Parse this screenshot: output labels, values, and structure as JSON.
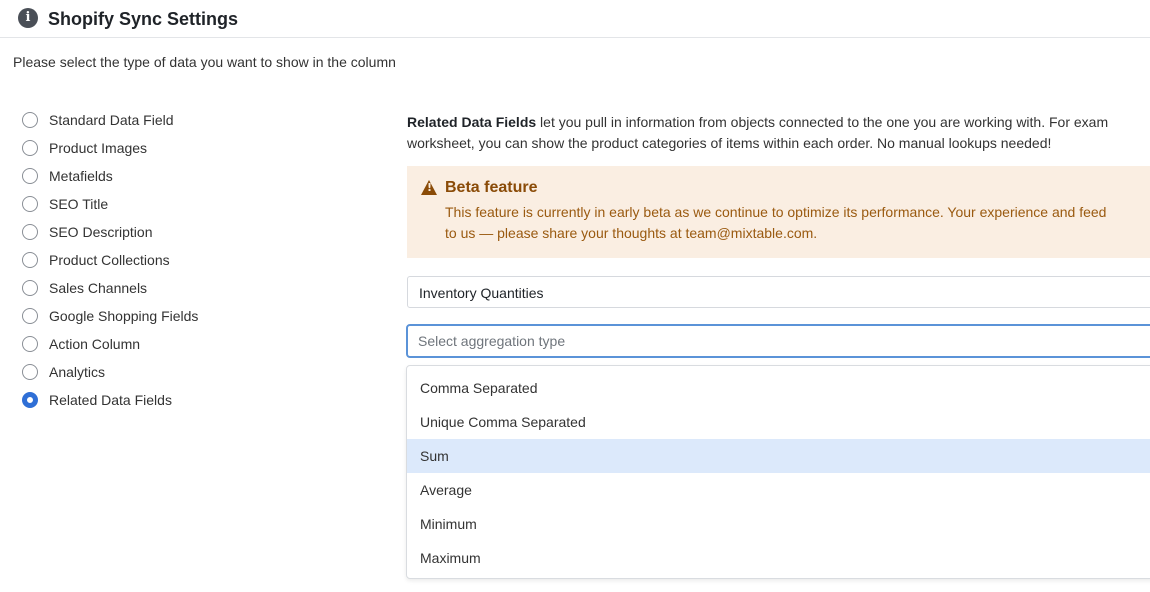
{
  "header": {
    "title": "Shopify Sync Settings",
    "icon": "info-icon"
  },
  "instruction": "Please select the type of data you want to show in the column",
  "data_types": {
    "selected": "Related Data Fields",
    "items": [
      {
        "label": "Standard Data Field",
        "checked": false
      },
      {
        "label": "Product Images",
        "checked": false
      },
      {
        "label": "Metafields",
        "checked": false
      },
      {
        "label": "SEO Title",
        "checked": false
      },
      {
        "label": "SEO Description",
        "checked": false
      },
      {
        "label": "Product Collections",
        "checked": false
      },
      {
        "label": "Sales Channels",
        "checked": false
      },
      {
        "label": "Google Shopping Fields",
        "checked": false
      },
      {
        "label": "Action Column",
        "checked": false
      },
      {
        "label": "Analytics",
        "checked": false
      },
      {
        "label": "Related Data Fields",
        "checked": true
      }
    ]
  },
  "description": {
    "bold": "Related Data Fields",
    "line1_rest": " let you pull in information from objects connected to the one you are working with. For exam",
    "line2": "worksheet, you can show the product categories of items within each order. No manual lookups needed!"
  },
  "beta": {
    "title": "Beta feature",
    "line1": "This feature is currently in early beta as we continue to optimize its performance. Your experience and feed",
    "line2": "to us — please share your thoughts at team@mixtable.com.",
    "icon": "warning-icon"
  },
  "related_field": {
    "value": "Inventory Quantities"
  },
  "aggregation": {
    "placeholder": "Select aggregation type",
    "value": "",
    "options": [
      "Comma Separated",
      "Unique Comma Separated",
      "Sum",
      "Average",
      "Minimum",
      "Maximum"
    ],
    "highlighted": "Sum"
  },
  "colors": {
    "accent": "#2f6fd6",
    "warning_bg": "#faeee2",
    "warning_text": "#8a4b07",
    "highlight": "#dce9fb"
  }
}
